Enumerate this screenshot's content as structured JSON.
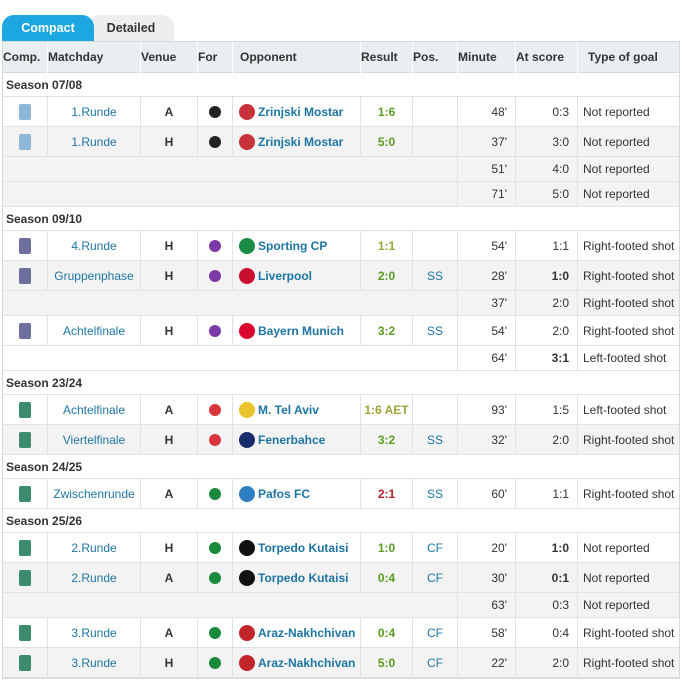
{
  "tabs": {
    "compact": "Compact",
    "detailed": "Detailed"
  },
  "headers": {
    "comp": "Comp.",
    "matchday": "Matchday",
    "venue": "Venue",
    "for": "For",
    "opponent": "Opponent",
    "result": "Result",
    "pos": "Pos.",
    "minute": "Minute",
    "at_score": "At score",
    "type": "Type of goal"
  },
  "colors": {
    "accent": "#1ca7e0",
    "link": "#1d75a3",
    "win": "#5a9b1f",
    "draw": "#9ea33a",
    "loss": "#b5222b"
  },
  "rows": [
    {
      "kind": "season",
      "label": "Season 07/08"
    },
    {
      "kind": "match",
      "comp_icon": "uefa-cup-icon",
      "matchday": "1.Runde",
      "venue": "A",
      "for_icon": "partizan-crest-icon",
      "opp_icon": "zrinjski-crest-icon",
      "opponent": "Zrinjski Mostar",
      "result": "1:6",
      "result_class": "win",
      "pos": "",
      "minute": "48'",
      "at_score": "0:3",
      "at_score_bold": false,
      "type": "Not reported"
    },
    {
      "kind": "match",
      "comp_icon": "uefa-cup-icon",
      "matchday": "1.Runde",
      "venue": "H",
      "for_icon": "partizan-crest-icon",
      "opp_icon": "zrinjski-crest-icon",
      "opponent": "Zrinjski Mostar",
      "result": "5:0",
      "result_class": "win",
      "pos": "",
      "minute": "37'",
      "at_score": "3:0",
      "at_score_bold": false,
      "type": "Not reported"
    },
    {
      "kind": "extra",
      "minute": "51'",
      "at_score": "4:0",
      "at_score_bold": false,
      "type": "Not reported"
    },
    {
      "kind": "extra",
      "minute": "71'",
      "at_score": "5:0",
      "at_score_bold": false,
      "type": "Not reported"
    },
    {
      "kind": "season",
      "label": "Season 09/10"
    },
    {
      "kind": "match",
      "comp_icon": "champions-league-icon",
      "matchday": "4.Runde",
      "venue": "H",
      "for_icon": "fiorentina-crest-icon",
      "opp_icon": "sporting-crest-icon",
      "opponent": "Sporting CP",
      "result": "1:1",
      "result_class": "draw",
      "pos": "",
      "minute": "54'",
      "at_score": "1:1",
      "at_score_bold": false,
      "type": "Right-footed shot"
    },
    {
      "kind": "match",
      "comp_icon": "champions-league-icon",
      "matchday": "Gruppenphase",
      "venue": "H",
      "for_icon": "fiorentina-crest-icon",
      "opp_icon": "liverpool-crest-icon",
      "opponent": "Liverpool",
      "result": "2:0",
      "result_class": "win",
      "pos": "SS",
      "minute": "28'",
      "at_score": "1:0",
      "at_score_bold": true,
      "type": "Right-footed shot"
    },
    {
      "kind": "extra",
      "minute": "37'",
      "at_score": "2:0",
      "at_score_bold": false,
      "type": "Right-footed shot"
    },
    {
      "kind": "match",
      "comp_icon": "champions-league-icon",
      "matchday": "Achtelfinale",
      "venue": "H",
      "for_icon": "fiorentina-crest-icon",
      "opp_icon": "bayern-crest-icon",
      "opponent": "Bayern Munich",
      "result": "3:2",
      "result_class": "win",
      "pos": "SS",
      "minute": "54'",
      "at_score": "2:0",
      "at_score_bold": false,
      "type": "Right-footed shot"
    },
    {
      "kind": "extra",
      "minute": "64'",
      "at_score": "3:1",
      "at_score_bold": true,
      "type": "Left-footed shot"
    },
    {
      "kind": "season",
      "label": "Season 23/24"
    },
    {
      "kind": "match",
      "comp_icon": "conference-league-icon",
      "matchday": "Achtelfinale",
      "venue": "A",
      "for_icon": "olympiacos-crest-icon",
      "opp_icon": "maccabi-crest-icon",
      "opponent": "M. Tel Aviv",
      "result": "1:6 AET",
      "result_class": "draw",
      "pos": "",
      "minute": "93'",
      "at_score": "1:5",
      "at_score_bold": false,
      "type": "Left-footed shot"
    },
    {
      "kind": "match",
      "comp_icon": "conference-league-icon",
      "matchday": "Viertelfinale",
      "venue": "H",
      "for_icon": "olympiacos-crest-icon",
      "opp_icon": "fenerbahce-crest-icon",
      "opponent": "Fenerbahce",
      "result": "3:2",
      "result_class": "win",
      "pos": "SS",
      "minute": "32'",
      "at_score": "2:0",
      "at_score_bold": false,
      "type": "Right-footed shot"
    },
    {
      "kind": "season",
      "label": "Season 24/25"
    },
    {
      "kind": "match",
      "comp_icon": "conference-league-icon",
      "matchday": "Zwischenrunde",
      "venue": "A",
      "for_icon": "panathinaikos-crest-icon",
      "opp_icon": "pafos-crest-icon",
      "opponent": "Pafos FC",
      "result": "2:1",
      "result_class": "loss",
      "pos": "SS",
      "minute": "60'",
      "at_score": "1:1",
      "at_score_bold": false,
      "type": "Right-footed shot"
    },
    {
      "kind": "season",
      "label": "Season 25/26"
    },
    {
      "kind": "match",
      "comp_icon": "conference-league-icon",
      "matchday": "2.Runde",
      "venue": "H",
      "for_icon": "panathinaikos-crest-icon",
      "opp_icon": "torpedo-crest-icon",
      "opponent": "Torpedo Kutaisi",
      "result": "1:0",
      "result_class": "win",
      "pos": "CF",
      "minute": "20'",
      "at_score": "1:0",
      "at_score_bold": true,
      "type": "Not reported"
    },
    {
      "kind": "match",
      "comp_icon": "conference-league-icon",
      "matchday": "2.Runde",
      "venue": "A",
      "for_icon": "panathinaikos-crest-icon",
      "opp_icon": "torpedo-crest-icon",
      "opponent": "Torpedo Kutaisi",
      "result": "0:4",
      "result_class": "win",
      "pos": "CF",
      "minute": "30'",
      "at_score": "0:1",
      "at_score_bold": true,
      "type": "Not reported"
    },
    {
      "kind": "extra",
      "minute": "63'",
      "at_score": "0:3",
      "at_score_bold": false,
      "type": "Not reported"
    },
    {
      "kind": "match",
      "comp_icon": "conference-league-icon",
      "matchday": "3.Runde",
      "venue": "A",
      "for_icon": "panathinaikos-crest-icon",
      "opp_icon": "araz-crest-icon",
      "opponent": "Araz-Nakhchivan",
      "result": "0:4",
      "result_class": "win",
      "pos": "CF",
      "minute": "58'",
      "at_score": "0:4",
      "at_score_bold": false,
      "type": "Right-footed shot"
    },
    {
      "kind": "match",
      "comp_icon": "conference-league-icon",
      "matchday": "3.Runde",
      "venue": "H",
      "for_icon": "panathinaikos-crest-icon",
      "opp_icon": "araz-crest-icon",
      "opponent": "Araz-Nakhchivan",
      "result": "5:0",
      "result_class": "win",
      "pos": "CF",
      "minute": "22'",
      "at_score": "2:0",
      "at_score_bold": false,
      "type": "Right-footed shot"
    }
  ]
}
